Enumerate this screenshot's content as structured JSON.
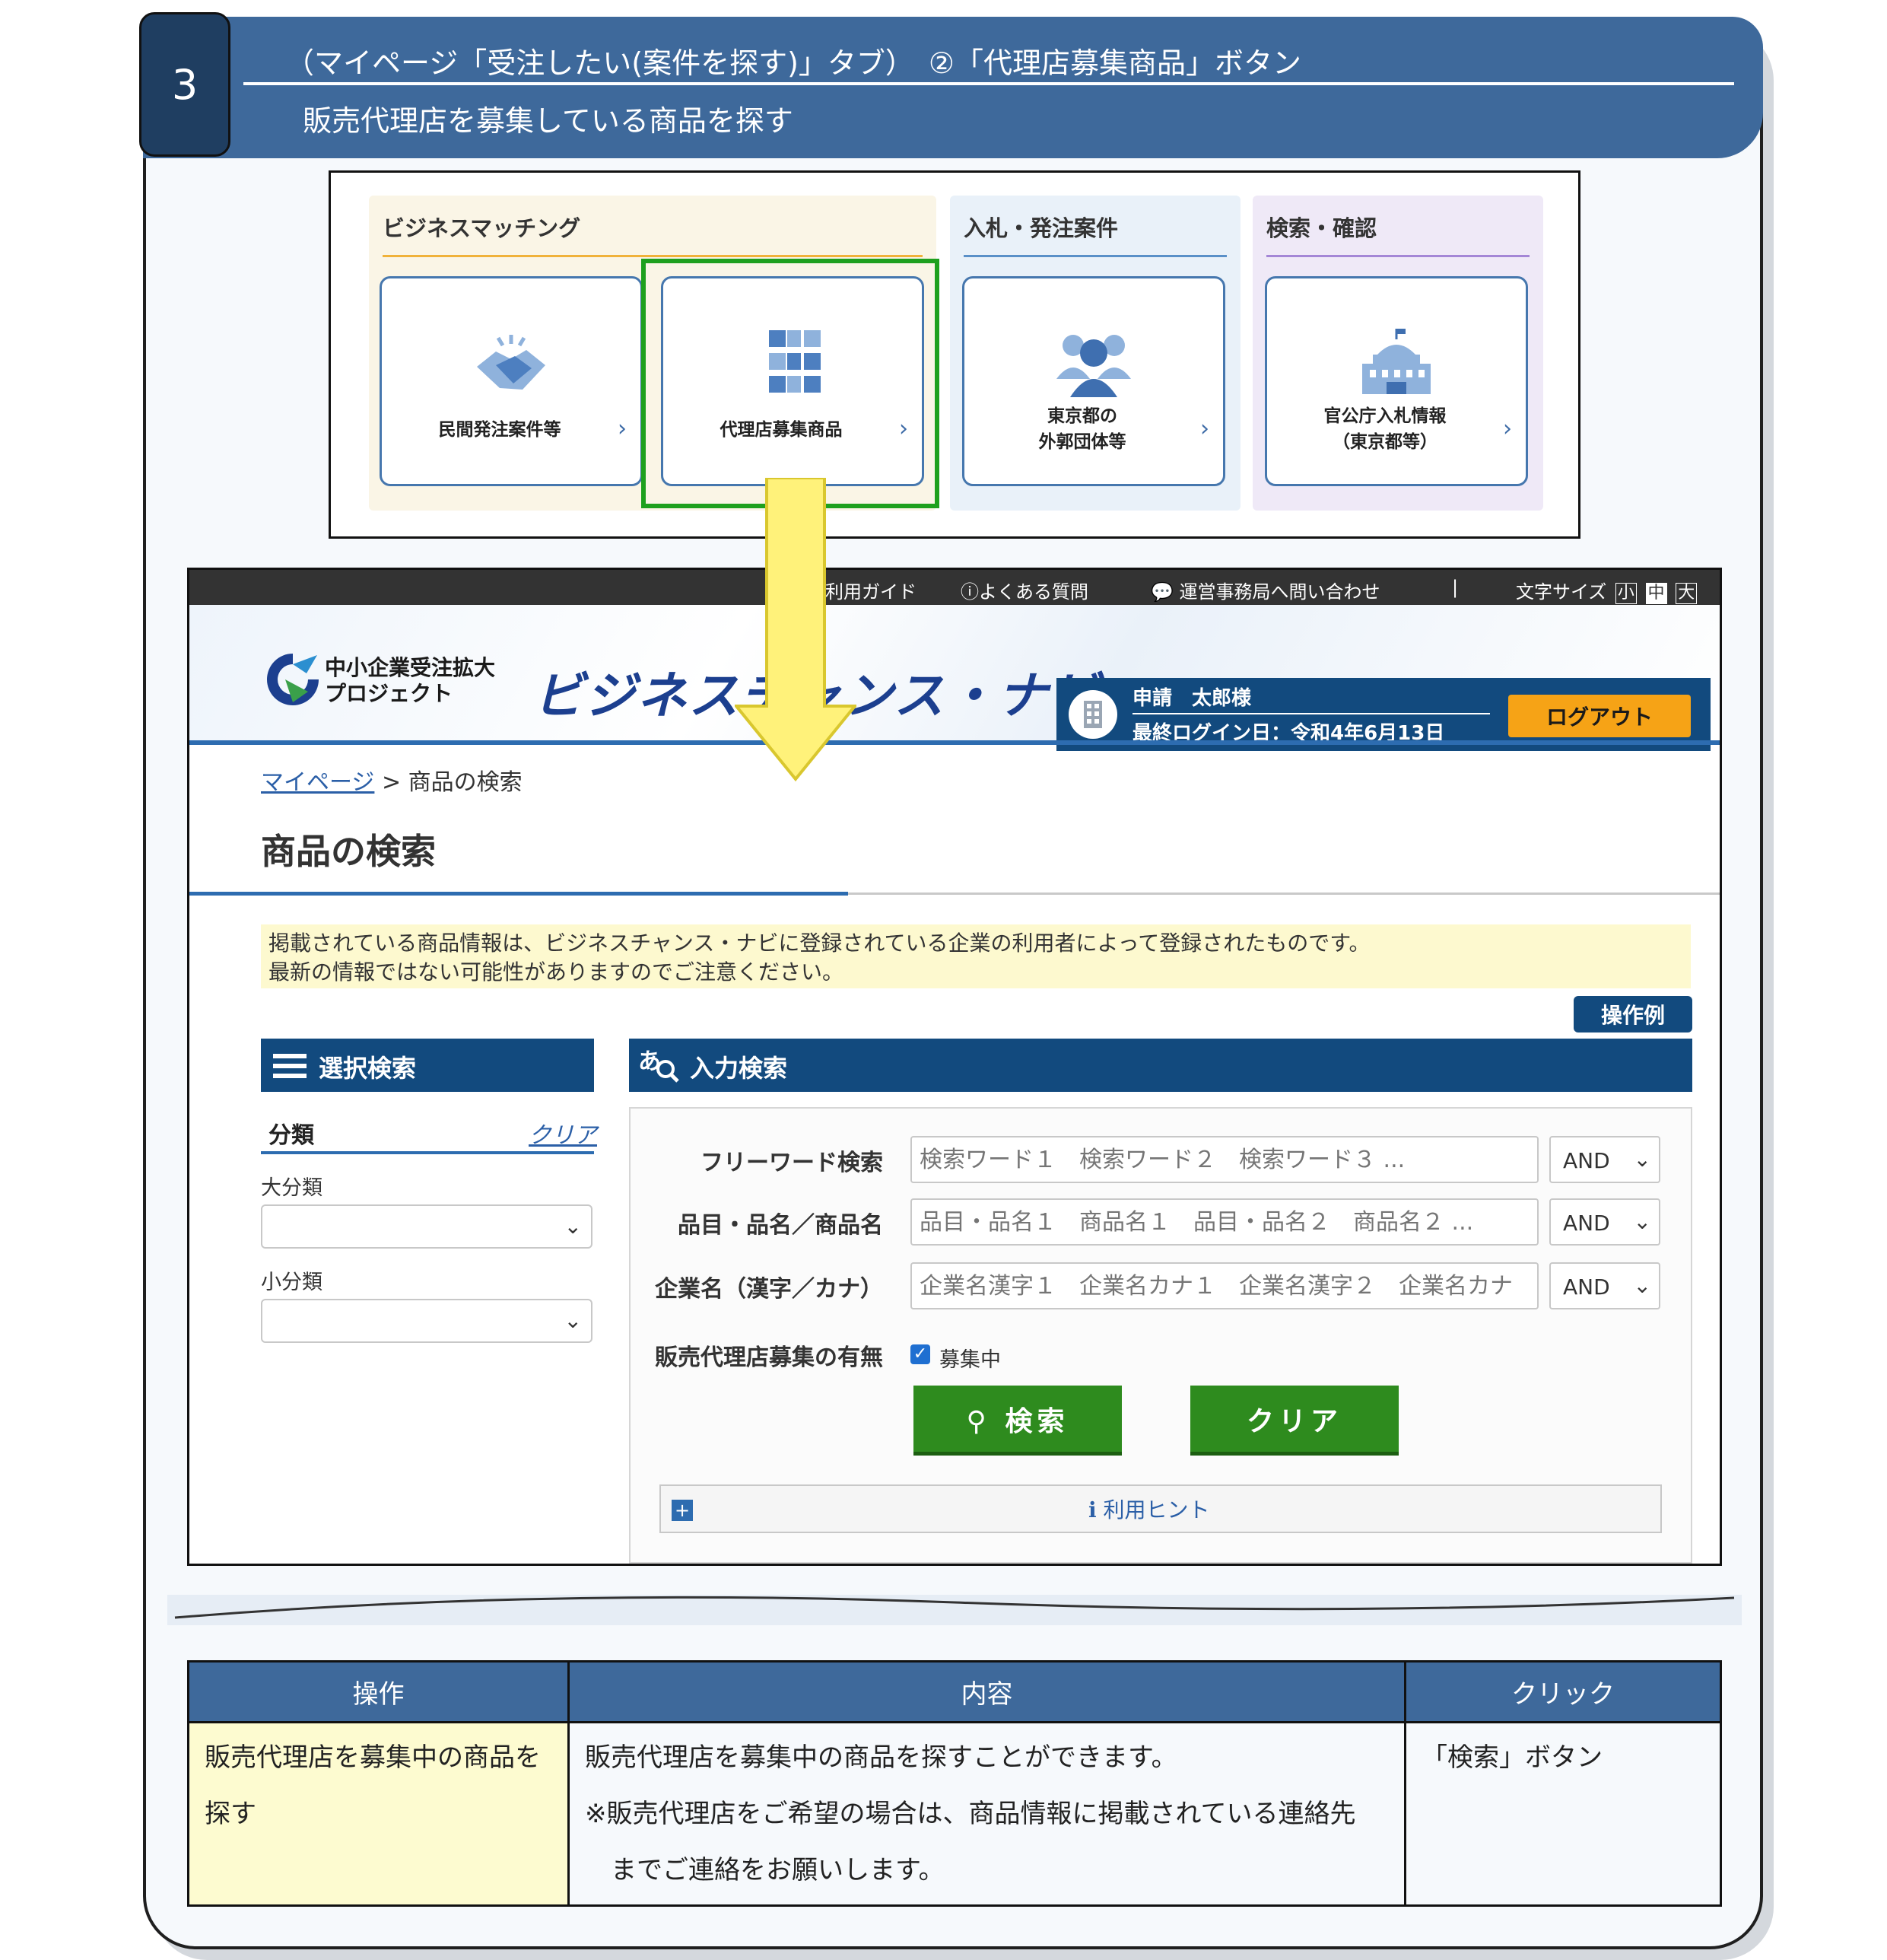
{
  "step": {
    "number": "3",
    "line1": "（マイページ「受注したい(案件を探す)」タブ）　②「代理店募集商品」ボタン",
    "line2": "販売代理店を募集している商品を探す"
  },
  "menu": {
    "sections": [
      {
        "title": "ビジネスマッチング"
      },
      {
        "title": "入札・発注案件"
      },
      {
        "title": "検索・確認"
      }
    ],
    "tiles": [
      {
        "label": "民間発注案件等"
      },
      {
        "label": "代理店募集商品"
      },
      {
        "line1": "東京都の",
        "line2": "外郭団体等"
      },
      {
        "line1": "官公庁入札情報",
        "line2": "（東京都等）"
      }
    ],
    "chevron": "›"
  },
  "site": {
    "topbar": {
      "guide": "利用ガイド",
      "faq": "よくある質問",
      "contact": "運営事務局へ問い合わせ",
      "divider": "|",
      "font_size": "文字サイズ",
      "font_small": "小",
      "font_mid": "中",
      "font_large": "大"
    },
    "logo_line1": "中小企業受注拡大",
    "logo_line2": "プロジェクト",
    "brand": "ビジネスチャンス・ナビ",
    "user_name": "申請　太郎様",
    "last_login": "最終ログイン日：令和4年6月13日",
    "logout": "ログアウト",
    "breadcrumb_home": "マイページ",
    "breadcrumb_sep": ">",
    "breadcrumb_current": "商品の検索",
    "page_title": "商品の検索",
    "notice_line1": "掲載されている商品情報は、ビジネスチャンス・ナビに登録されている企業の利用者によって登録されたものです。",
    "notice_line2": "最新の情報ではない可能性がありますのでご注意ください。",
    "example_button": "操作例",
    "select_search": {
      "title": "選択検索",
      "category": "分類",
      "clear": "クリア",
      "major": "大分類",
      "minor": "小分類"
    },
    "input_search": {
      "title": "入力検索",
      "free_word_label": "フリーワード検索",
      "free_word_placeholder": "検索ワード１　検索ワード２　検索ワード３ ...",
      "item_label": "品目・品名／商品名",
      "item_placeholder": "品目・品名１　商品名１　品目・品名２　商品名２ ...",
      "company_label": "企業名（漢字／カナ）",
      "company_placeholder": "企業名漢字１　企業名カナ１　企業名漢字２　企業名カナ",
      "operator": "AND",
      "recruit_label": "販売代理店募集の有無",
      "recruit_option": "募集中",
      "search_button": "検索",
      "clear_button": "クリア",
      "hint": "利用ヒント"
    }
  },
  "table": {
    "headers": [
      "操作",
      "内容",
      "クリック"
    ],
    "row": {
      "operation_line1": "販売代理店を募集中の商品を",
      "operation_line2": "探す",
      "content_line1": "販売代理店を募集中の商品を探すことができます。",
      "content_line2": "※販売代理店をご希望の場合は、商品情報に掲載されている連絡先",
      "content_line3": "　までご連絡をお願いします。",
      "click": "「検索」ボタン"
    }
  },
  "colors": {
    "banner": "#3e699b",
    "badge": "#1f3e61",
    "navy": "#124a7e",
    "green_button": "#2e8b1e",
    "highlight_box": "#1ea01e",
    "logout": "#f6a316",
    "arrow": "#fff27a"
  }
}
